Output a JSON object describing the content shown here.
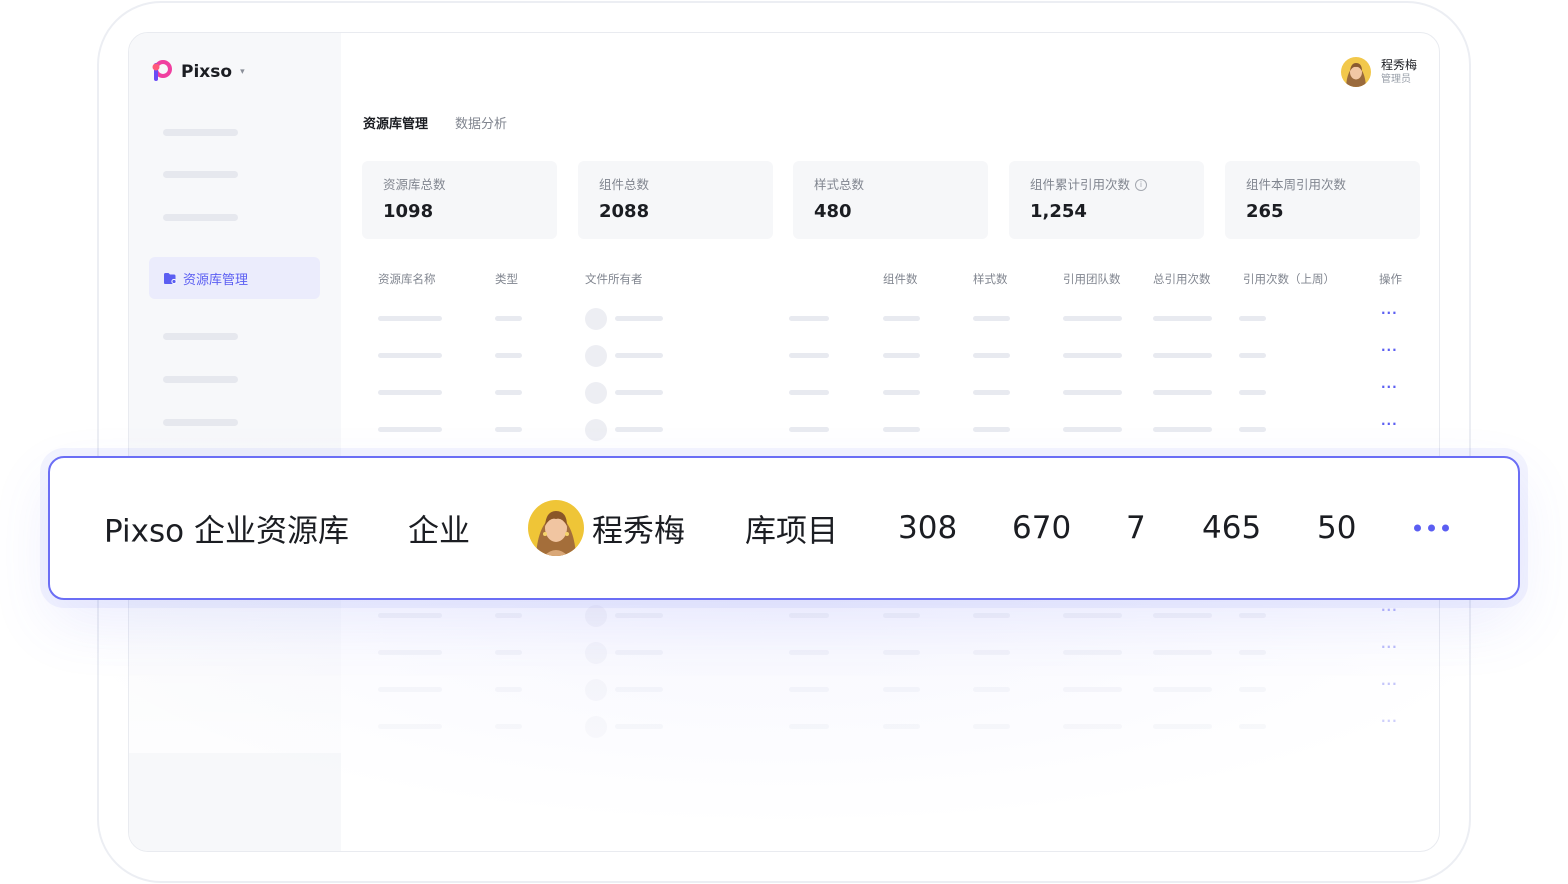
{
  "brand": {
    "name": "Pixso",
    "caret": "▾",
    "accent": "#5b5ef2"
  },
  "user": {
    "name": "程秀梅",
    "role": "管理员"
  },
  "sidebar": {
    "active_item": "资源库管理"
  },
  "tabs": [
    {
      "label": "资源库管理",
      "active": true
    },
    {
      "label": "数据分析",
      "active": false
    }
  ],
  "stats": [
    {
      "label": "资源库总数",
      "value": "1098"
    },
    {
      "label": "组件总数",
      "value": "2088"
    },
    {
      "label": "样式总数",
      "value": "480"
    },
    {
      "label": "组件累计引用次数",
      "value": "1,254",
      "info_icon": "info-icon"
    },
    {
      "label": "组件本周引用次数",
      "value": "265"
    }
  ],
  "table": {
    "columns": [
      "资源库名称",
      "类型",
      "文件所有者",
      "组件数",
      "样式数",
      "引用团队数",
      "总引用次数",
      "引用次数（上周）",
      "操作"
    ],
    "more_glyph": "···"
  },
  "highlight_row": {
    "name": "Pixso 企业资源库",
    "type": "企业",
    "owner": "程秀梅",
    "project": "库项目",
    "components": "308",
    "styles": "670",
    "teams": "7",
    "total_refs": "465",
    "last_week_refs": "50"
  }
}
